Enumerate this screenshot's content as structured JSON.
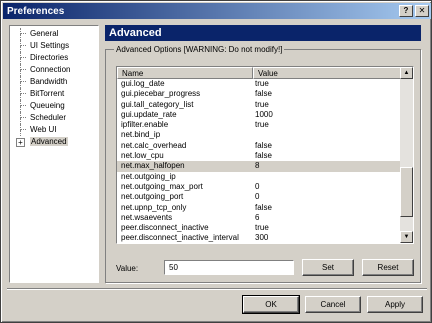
{
  "window": {
    "title": "Preferences"
  },
  "sidebar": {
    "items": [
      {
        "label": "General"
      },
      {
        "label": "UI Settings"
      },
      {
        "label": "Directories"
      },
      {
        "label": "Connection"
      },
      {
        "label": "Bandwidth"
      },
      {
        "label": "BitTorrent"
      },
      {
        "label": "Queueing"
      },
      {
        "label": "Scheduler"
      },
      {
        "label": "Web UI"
      },
      {
        "label": "Advanced",
        "selected": true,
        "expander": "+"
      }
    ]
  },
  "main": {
    "header": "Advanced",
    "group_title": "Advanced Options [WARNING: Do not modify!]",
    "table": {
      "columns": [
        "Name",
        "Value"
      ],
      "rows": [
        {
          "name": "gui.log_date",
          "value": "true"
        },
        {
          "name": "gui.piecebar_progress",
          "value": "false"
        },
        {
          "name": "gui.tall_category_list",
          "value": "true"
        },
        {
          "name": "gui.update_rate",
          "value": "1000"
        },
        {
          "name": "ipfilter.enable",
          "value": "true"
        },
        {
          "name": "net.bind_ip",
          "value": ""
        },
        {
          "name": "net.calc_overhead",
          "value": "false"
        },
        {
          "name": "net.low_cpu",
          "value": "false"
        },
        {
          "name": "net.max_halfopen",
          "value": "8",
          "selected": true
        },
        {
          "name": "net.outgoing_ip",
          "value": ""
        },
        {
          "name": "net.outgoing_max_port",
          "value": "0"
        },
        {
          "name": "net.outgoing_port",
          "value": "0"
        },
        {
          "name": "net.upnp_tcp_only",
          "value": "false"
        },
        {
          "name": "net.wsaevents",
          "value": "6"
        },
        {
          "name": "peer.disconnect_inactive",
          "value": "true"
        },
        {
          "name": "peer.disconnect_inactive_interval",
          "value": "300"
        }
      ]
    },
    "value_label": "Value:",
    "value_input": "50",
    "set_label": "Set",
    "reset_label": "Reset"
  },
  "footer": {
    "ok_label": "OK",
    "cancel_label": "Cancel",
    "apply_label": "Apply"
  },
  "colors": {
    "header_bg": "#0a246a",
    "title_gradient_start": "#0a246a",
    "title_gradient_end": "#a6caf0",
    "selection_bg": "#d4d0c8"
  }
}
